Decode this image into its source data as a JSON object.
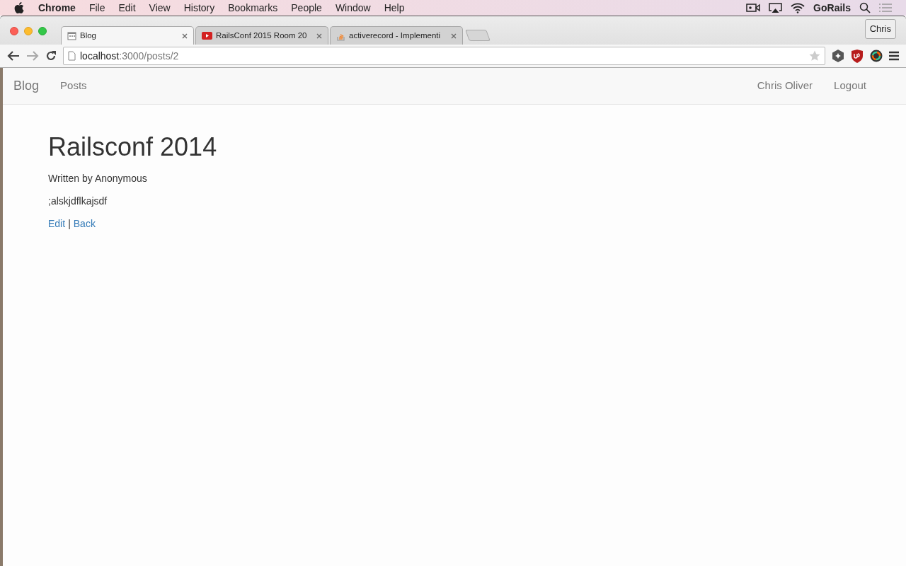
{
  "menu_bar": {
    "app": "Chrome",
    "items": [
      "File",
      "Edit",
      "View",
      "History",
      "Bookmarks",
      "People",
      "Window",
      "Help"
    ],
    "status_label": "GoRails"
  },
  "tabs": [
    {
      "label": "Blog",
      "kind": "calendar",
      "selected": true
    },
    {
      "label": "RailsConf 2015 Room 20",
      "kind": "video",
      "selected": false
    },
    {
      "label": "activerecord - Implementi",
      "kind": "stack",
      "selected": false
    }
  ],
  "profile": "Chris",
  "address_bar": {
    "host": "localhost",
    "path": ":3000/posts/2"
  },
  "navbar": {
    "brand": "Blog",
    "left_links": [
      "Posts"
    ],
    "right_links": [
      "Chris Oliver",
      "Logout"
    ]
  },
  "post": {
    "title": "Railsconf 2014",
    "byline": "Written by Anonymous",
    "body": ";alskjdflkajsdf",
    "links": [
      "Edit",
      "Back"
    ],
    "separator": "|"
  }
}
